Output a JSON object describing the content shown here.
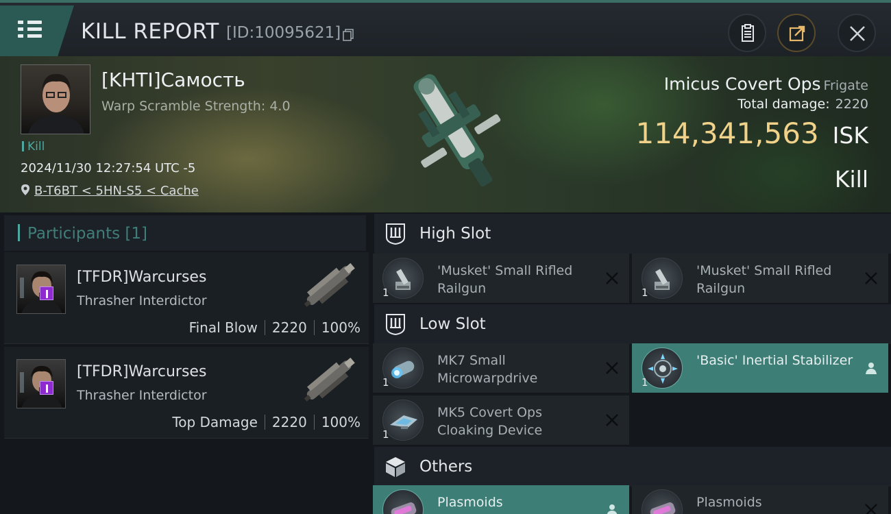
{
  "header": {
    "title": "KILL REPORT",
    "report_id": "[ID:10095621]"
  },
  "victim": {
    "name": "[KHTI]Самость",
    "warp_label": "Warp Scramble Strength:",
    "warp_value": "4.0",
    "kill_tag": "Kill",
    "timestamp": "2024/11/30 12:27:54 UTC -5",
    "location": "B-T6BT < 5HN-S5 < Cache",
    "ship_name": "Imicus Covert Ops",
    "ship_class": "Frigate",
    "total_damage_label": "Total damage:",
    "total_damage": "2220",
    "isk_value": "114,341,563",
    "isk_unit": "ISK",
    "result": "Kill"
  },
  "participants": {
    "title": "Participants",
    "count": "[1]",
    "rows": [
      {
        "name": "[TFDR]Warcurses",
        "ship": "Thrasher Interdictor",
        "role": "Final Blow",
        "damage": "2220",
        "percent": "100%"
      },
      {
        "name": "[TFDR]Warcurses",
        "ship": "Thrasher Interdictor",
        "role": "Top Damage",
        "damage": "2220",
        "percent": "100%"
      }
    ]
  },
  "sections": {
    "high": {
      "title": "High Slot",
      "items": [
        {
          "name": "'Musket' Small Rifled Railgun",
          "qty": "1",
          "icon": "railgun-icon",
          "state": "destroyed"
        },
        {
          "name": "'Musket' Small Rifled Railgun",
          "qty": "1",
          "icon": "railgun-icon",
          "state": "destroyed"
        }
      ]
    },
    "low": {
      "title": "Low Slot",
      "items": [
        {
          "name": "MK7 Small Microwarpdrive",
          "qty": "1",
          "icon": "microwarpdrive-icon",
          "state": "destroyed"
        },
        {
          "name": "'Basic' Inertial Stabilizer",
          "qty": "1",
          "icon": "stabilizer-icon",
          "state": "dropped"
        },
        {
          "name": "MK5 Covert Ops Cloaking Device",
          "qty": "1",
          "icon": "cloak-icon",
          "state": "destroyed"
        }
      ]
    },
    "others": {
      "title": "Others",
      "items": [
        {
          "name": "Plasmoids",
          "icon": "plasmoid-icon",
          "state": "dropped"
        },
        {
          "name": "Plasmoids",
          "icon": "plasmoid-icon",
          "state": "destroyed"
        }
      ]
    }
  },
  "colors": {
    "accent": "#4fa7a0",
    "isk": "#f0d28a",
    "active_row": "#3d7e77",
    "badge": "#8e2bd0"
  }
}
